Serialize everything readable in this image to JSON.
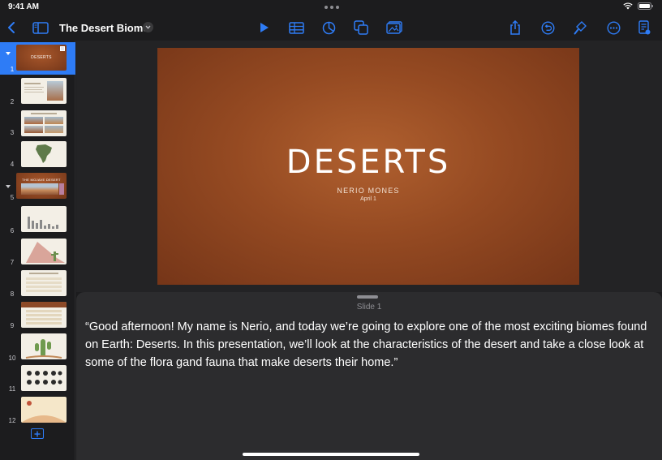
{
  "status": {
    "time": "9:41 AM"
  },
  "toolbar": {
    "title": "The Desert Biome",
    "icons": [
      "back-icon",
      "sidebar-toggle-icon",
      "play-icon",
      "table-icon",
      "chart-icon",
      "shapes-icon",
      "media-icon",
      "share-icon",
      "undo-icon",
      "format-brush-icon",
      "more-icon",
      "document-icon"
    ]
  },
  "navigator": {
    "slides": [
      {
        "number": "1",
        "title": "DESERTS",
        "selected": true,
        "group": true
      },
      {
        "number": "2"
      },
      {
        "number": "3"
      },
      {
        "number": "4"
      },
      {
        "number": "5",
        "title": "THE MOJAVE DESERT",
        "group": true
      },
      {
        "number": "6"
      },
      {
        "number": "7"
      },
      {
        "number": "8"
      },
      {
        "number": "9"
      },
      {
        "number": "10"
      },
      {
        "number": "11"
      },
      {
        "number": "12"
      }
    ]
  },
  "slide": {
    "title": "DESERTS",
    "author": "NERIO MONES",
    "date": "April 1"
  },
  "notes": {
    "label": "Slide 1",
    "text": "“Good afternoon! My name is Nerio, and today we’re going to explore one of the most exciting biomes found on Earth: Deserts. In this presentation, we’ll look at the characteristics of the desert and take a close look at some of the flora gand fauna that make deserts their home.”"
  },
  "colors": {
    "accent": "#2e7cf6",
    "slide_bg": "#954a22",
    "app_bg": "#1c1c1e"
  }
}
